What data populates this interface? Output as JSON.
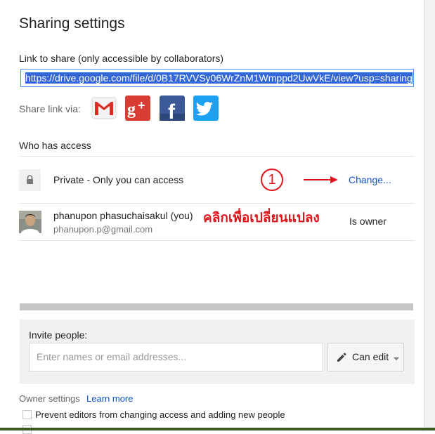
{
  "dialog": {
    "title": "Sharing settings",
    "link_label": "Link to share (only accessible by collaborators)",
    "link_value": "https://drive.google.com/file/d/0B17RVVSy06WrZnM1Wmppd2UwVkE/view?usp=sharing",
    "share_via_label": "Share link via:",
    "social_icons": [
      "gmail-icon",
      "google-plus-icon",
      "facebook-icon",
      "twitter-icon"
    ],
    "who_has_access": "Who has access",
    "private_label": "Private - Only you can access",
    "change_link": "Change...",
    "annotation_number": "1",
    "annotation_text": "คลิกเพื่อเปลี่ยนแปลง",
    "owner_name": "phanupon phasuchaisakul (you)",
    "owner_email": "phanupon.p@gmail.com",
    "owner_role": "Is owner",
    "invite_label": "Invite people:",
    "invite_placeholder": "Enter names or email addresses...",
    "can_edit_label": "Can edit",
    "owner_settings": "Owner settings",
    "learn_more": "Learn more",
    "prevent_editors": "Prevent editors from changing access and adding new people"
  },
  "colors": {
    "link": "#1155cc",
    "annotation_red": "#e0151b",
    "selection": "#3367d6"
  }
}
